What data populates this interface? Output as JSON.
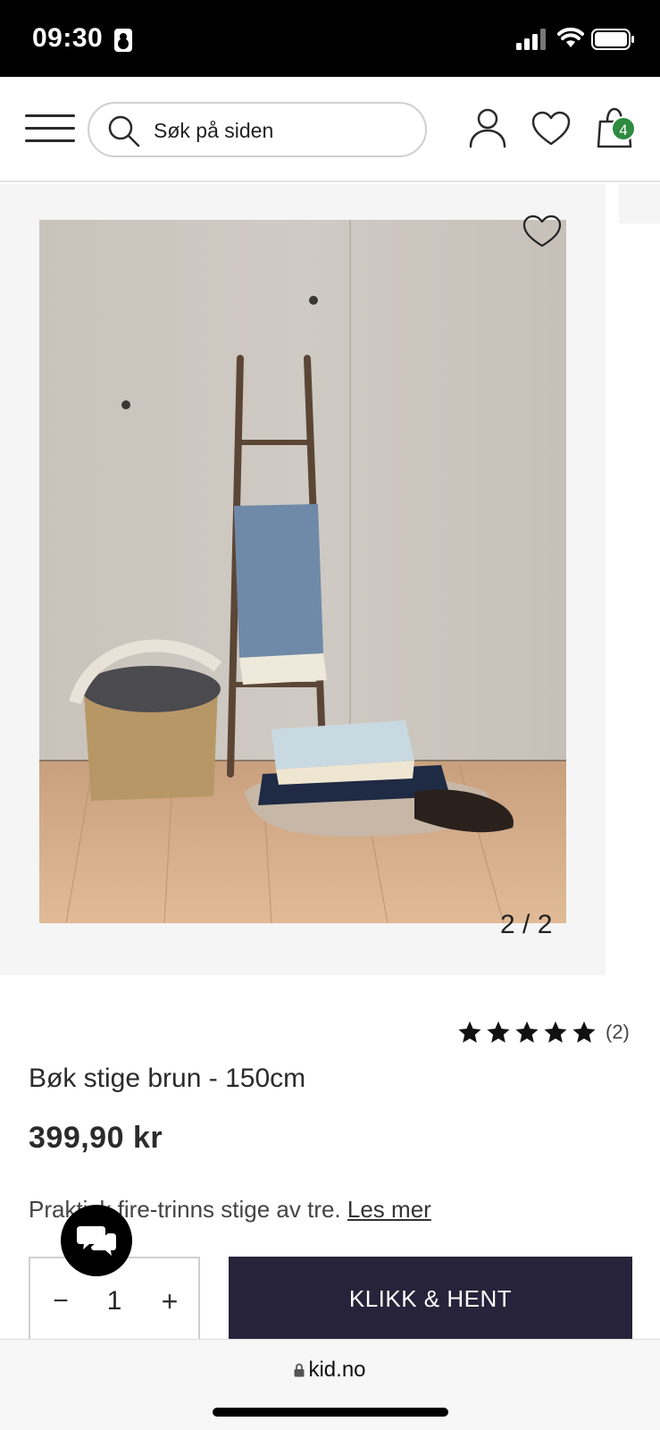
{
  "status_bar": {
    "time": "09:30",
    "icons": [
      "contact-badge-icon",
      "signal-icon",
      "wifi-icon",
      "battery-icon"
    ]
  },
  "header": {
    "search": {
      "placeholder": "Søk på siden",
      "value": ""
    },
    "cart_count": "4",
    "icons": [
      "menu-icon",
      "search-icon",
      "account-icon",
      "wishlist-icon",
      "cart-icon"
    ]
  },
  "gallery": {
    "slide_counter": "2 / 2",
    "icons": [
      "heart-icon"
    ]
  },
  "product": {
    "rating_stars": 5,
    "rating_count": "(2)",
    "title": "Bøk stige brun - 150cm",
    "price": "399,90 kr",
    "description": "Praktisk fire-trinns stige av tre.",
    "read_more": "Les mer"
  },
  "purchase": {
    "quantity": "1",
    "minus_label": "−",
    "plus_label": "+",
    "cta_label": "KLIKK & HENT"
  },
  "browser": {
    "url": "kid.no"
  },
  "colors": {
    "cta_background": "#27233a",
    "cart_badge": "#2e8b3f",
    "gallery_background": "#f5f5f5"
  }
}
